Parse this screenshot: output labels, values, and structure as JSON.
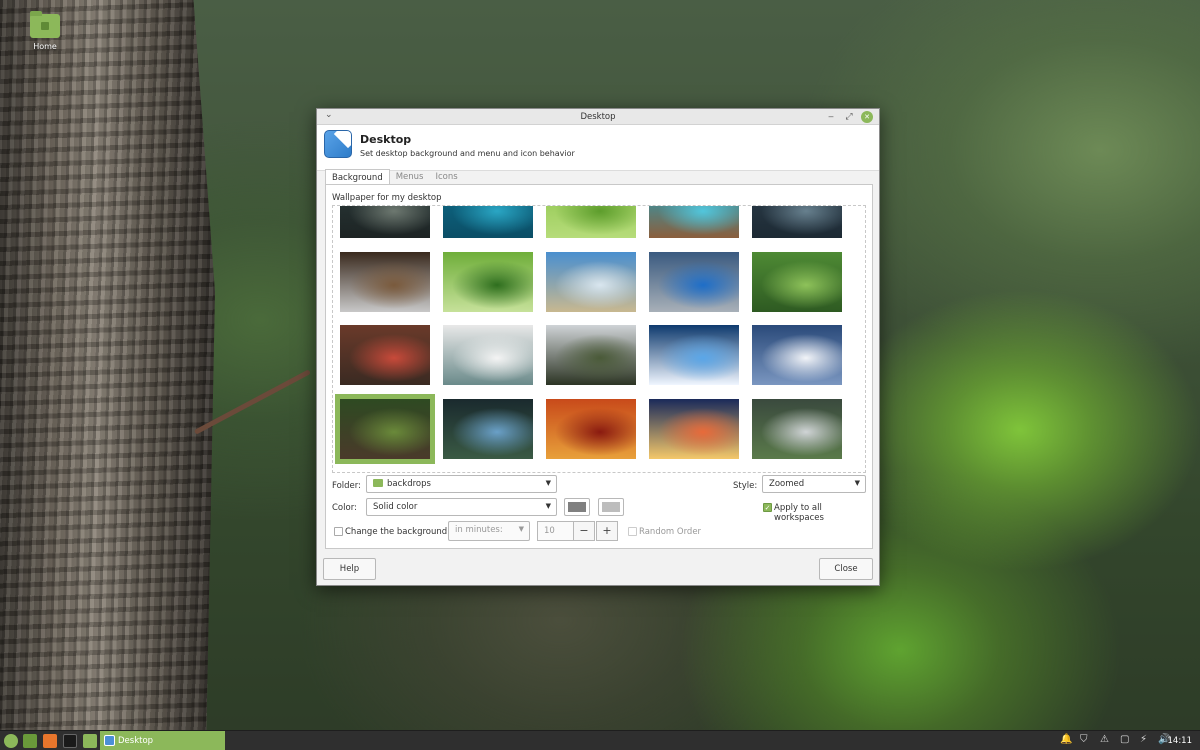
{
  "desktop": {
    "icons": [
      {
        "label": "Home"
      }
    ]
  },
  "window": {
    "title": "Desktop",
    "header": {
      "title": "Desktop",
      "subtitle": "Set desktop background and menu and icon behavior"
    },
    "tabs": [
      {
        "label": "Background",
        "active": true
      },
      {
        "label": "Menus",
        "active": false
      },
      {
        "label": "Icons",
        "active": false
      }
    ],
    "background": {
      "wallpaper_label": "Wallpaper for my desktop",
      "thumbnails": [
        {
          "name": "mountain-lake-evening",
          "colors": [
            "#2b3a3a",
            "#6d7870",
            "#1d2424"
          ]
        },
        {
          "name": "turquoise-water",
          "colors": [
            "#0e6e8c",
            "#2aa6c4",
            "#0b4e66"
          ]
        },
        {
          "name": "green-grass",
          "colors": [
            "#8bc34a",
            "#5d9d2c",
            "#b6dc7a"
          ]
        },
        {
          "name": "aerial-coastline",
          "colors": [
            "#1aa8c8",
            "#52c6dc",
            "#8b5e3c"
          ]
        },
        {
          "name": "pier-posts-water",
          "colors": [
            "#2d3e4c",
            "#67808e",
            "#1d2a34"
          ]
        },
        {
          "name": "coffee-beans-roaster",
          "colors": [
            "#3a2a1e",
            "#7a5a3c",
            "#c8c8c8"
          ]
        },
        {
          "name": "palm-leaf",
          "colors": [
            "#6fae3a",
            "#2e6e1e",
            "#c6e19a"
          ]
        },
        {
          "name": "dry-grass-sky",
          "colors": [
            "#4a8fcf",
            "#d9e6ef",
            "#c8b890"
          ]
        },
        {
          "name": "blue-railing",
          "colors": [
            "#3a5a80",
            "#1e6ec8",
            "#a8b0b8"
          ]
        },
        {
          "name": "green-hills",
          "colors": [
            "#4e8a34",
            "#8ec25a",
            "#2e5a22"
          ]
        },
        {
          "name": "toy-soldier-figure",
          "colors": [
            "#6a3a2a",
            "#c84a3a",
            "#3a2a22"
          ]
        },
        {
          "name": "statue-of-liberty-fog",
          "colors": [
            "#e8e8e8",
            "#f4f4f4",
            "#6a8a8a"
          ]
        },
        {
          "name": "terraced-hills-clouds",
          "colors": [
            "#cfd3d6",
            "#4a5a38",
            "#2c3424"
          ]
        },
        {
          "name": "ocean-sunburst",
          "colors": [
            "#0e3a6e",
            "#5aa6e8",
            "#f0f6ff"
          ]
        },
        {
          "name": "snowy-mountain",
          "colors": [
            "#2a4a7a",
            "#f2f4f8",
            "#7a96c0"
          ]
        },
        {
          "name": "tree-trunk-forest",
          "colors": [
            "#2e4a22",
            "#6a8a3a",
            "#4a3a2a"
          ]
        },
        {
          "name": "lake-forest-sky",
          "colors": [
            "#1a2a2e",
            "#6aa0c8",
            "#3a5a44"
          ]
        },
        {
          "name": "autumn-red-leaves",
          "colors": [
            "#c84a1a",
            "#8a1a10",
            "#e8a03a"
          ]
        },
        {
          "name": "sunset-clouds",
          "colors": [
            "#1a2a5a",
            "#e86a3a",
            "#f4c86a"
          ]
        },
        {
          "name": "misty-green-mountains",
          "colors": [
            "#3a4a3e",
            "#d0d4d6",
            "#5a7a4a"
          ]
        }
      ],
      "folder_label": "Folder:",
      "folder_value": "backdrops",
      "style_label": "Style:",
      "style_value": "Zoomed",
      "color_label": "Color:",
      "color_value": "Solid color",
      "primary_color": "#808080",
      "secondary_color": "#bdbdbd",
      "apply_all_label": "Apply to all workspaces",
      "apply_all_checked": true,
      "change_bg_label": "Change the background",
      "change_bg_checked": false,
      "interval_unit": "in minutes:",
      "interval_value": "10",
      "minus": "−",
      "plus": "+",
      "random_label": "Random Order",
      "random_checked": false
    },
    "buttons": {
      "help": "Help",
      "close": "Close"
    },
    "controls": {
      "menu": "⌄",
      "minimize": "‒",
      "maximize": "⤢",
      "close": "✕"
    }
  },
  "taskbar": {
    "active_task": "Desktop",
    "clock": "14:11",
    "accent": "#8cb85a"
  }
}
